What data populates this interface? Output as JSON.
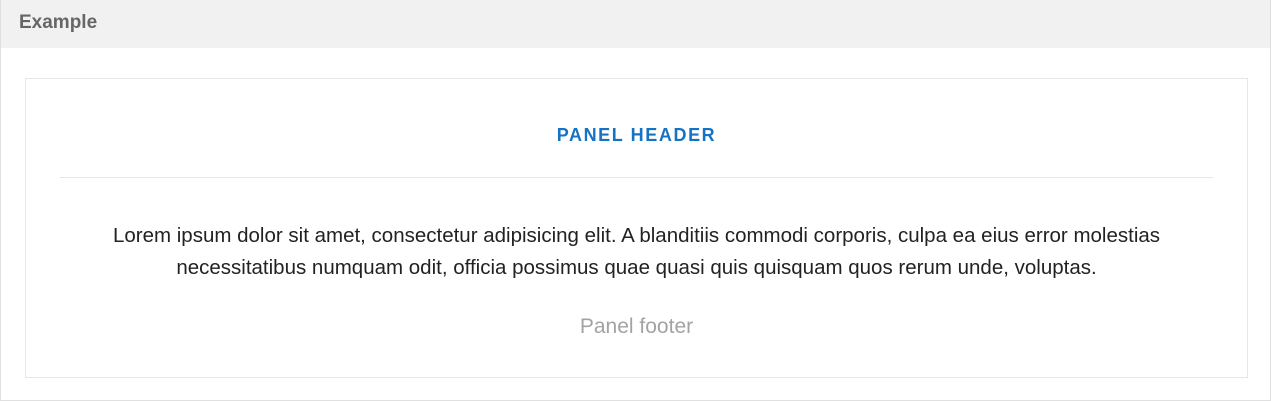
{
  "example": {
    "title": "Example"
  },
  "panel": {
    "header": "PANEL HEADER",
    "body": "Lorem ipsum dolor sit amet, consectetur adipisicing elit. A blanditiis commodi corporis, culpa ea eius error molestias necessitatibus numquam odit, officia possimus quae quasi quis quisquam quos rerum unde, voluptas.",
    "footer": "Panel footer"
  },
  "colors": {
    "header_accent": "#1673c4",
    "footer_text": "#a3a3a3",
    "title_bar": "#f1f1f1"
  }
}
